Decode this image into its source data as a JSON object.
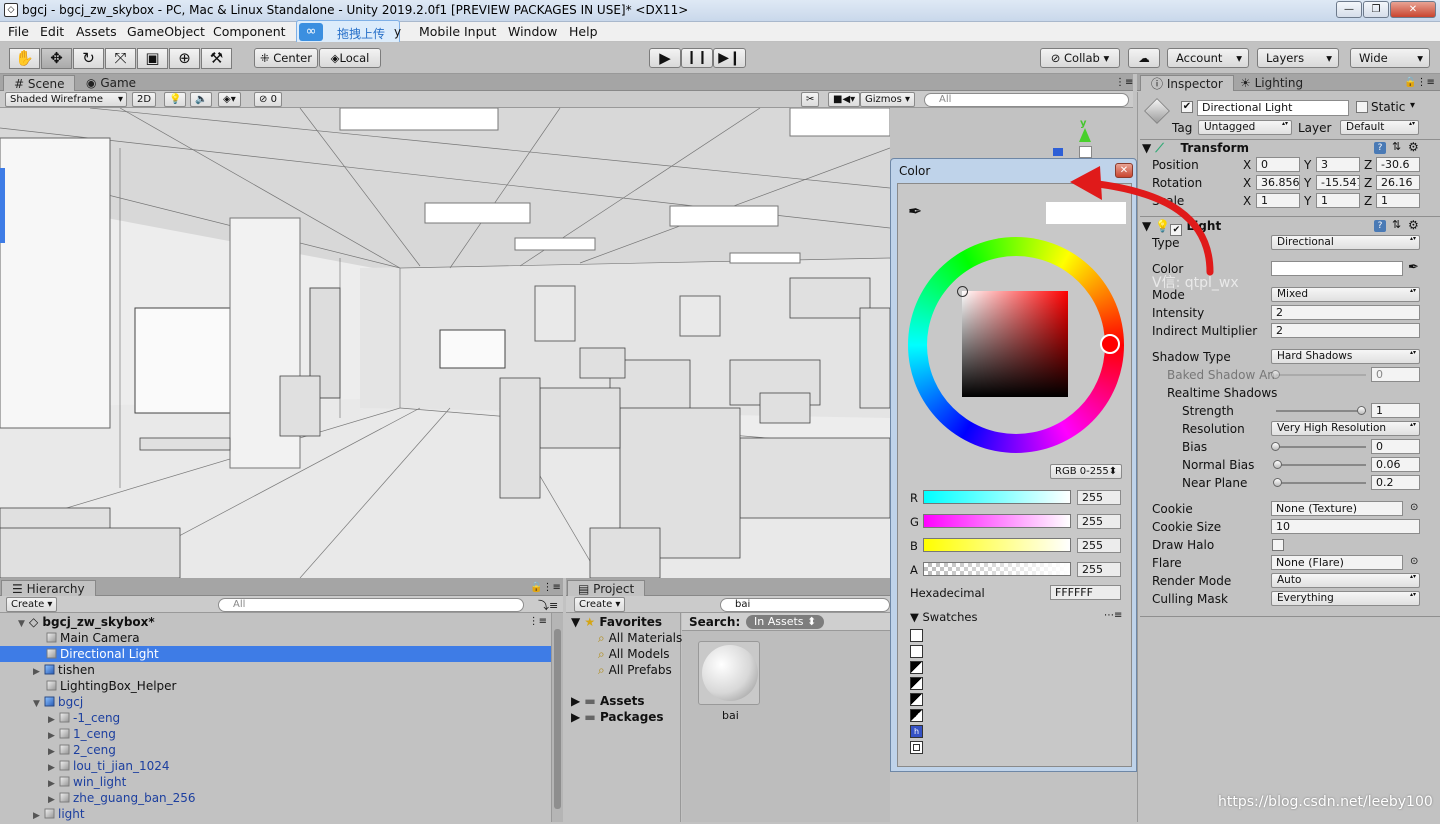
{
  "window": {
    "title": "bgcj - bgcj_zw_skybox - PC, Mac & Linux Standalone - Unity 2019.2.0f1 [PREVIEW PACKAGES IN USE]* <DX11>"
  },
  "menu": [
    "File",
    "Edit",
    "Assets",
    "GameObject",
    "Component",
    "Mobile Input",
    "Window",
    "Help"
  ],
  "overlay_popup": {
    "label": "拖拽上传",
    "trailing": "y"
  },
  "toolbar": {
    "center": "Center",
    "local": "Local",
    "collab": "Collab",
    "account": "Account",
    "layers": "Layers",
    "layout": "Wide"
  },
  "scene": {
    "tabs": [
      "Scene",
      "Game"
    ],
    "draw_mode": "Shaded Wireframe",
    "mode_2d": "2D",
    "hidden_count": "0",
    "gizmos": "Gizmos",
    "search_placeholder": "All"
  },
  "hierarchy": {
    "tab": "Hierarchy",
    "create": "Create",
    "search_placeholder": "All",
    "scene_name": "bgcj_zw_skybox*",
    "items": [
      {
        "label": "Main Camera"
      },
      {
        "label": "Directional Light"
      },
      {
        "label": "tishen"
      },
      {
        "label": "LightingBox_Helper"
      },
      {
        "label": "bgcj"
      },
      {
        "label": "-1_ceng"
      },
      {
        "label": "1_ceng"
      },
      {
        "label": "2_ceng"
      },
      {
        "label": "lou_ti_jian_1024"
      },
      {
        "label": "win_light"
      },
      {
        "label": "zhe_guang_ban_256"
      },
      {
        "label": "light"
      }
    ]
  },
  "project": {
    "tab": "Project",
    "create": "Create",
    "search_value": "bai",
    "favorites": "Favorites",
    "favorite_items": [
      "All Materials",
      "All Models",
      "All Prefabs"
    ],
    "folders": [
      "Assets",
      "Packages"
    ],
    "search_label": "Search:",
    "scope": "In Assets",
    "asset_name": "bai"
  },
  "color_picker": {
    "title": "Color",
    "mode": "RGB 0-255",
    "channels": [
      {
        "label": "R",
        "value": "255"
      },
      {
        "label": "G",
        "value": "255"
      },
      {
        "label": "B",
        "value": "255"
      },
      {
        "label": "A",
        "value": "255"
      }
    ],
    "hex_label": "Hexadecimal",
    "hex_value": "FFFFFF",
    "swatches_label": "Swatches",
    "swatch_fill": "#ffffff",
    "hue_marker_color": "#ff0000"
  },
  "inspector": {
    "tabs": [
      "Inspector",
      "Lighting"
    ],
    "object_name": "Directional Light",
    "static_label": "Static",
    "tag_label": "Tag",
    "tag_value": "Untagged",
    "layer_label": "Layer",
    "layer_value": "Default",
    "transform": {
      "title": "Transform",
      "position": {
        "label": "Position",
        "x": "0",
        "y": "3",
        "z": "-30.6"
      },
      "rotation": {
        "label": "Rotation",
        "x": "36.856",
        "y": "-15.547",
        "z": "26.16"
      },
      "scale": {
        "label": "Scale",
        "x": "1",
        "y": "1",
        "z": "1"
      }
    },
    "light": {
      "title": "Light",
      "type_label": "Type",
      "type_value": "Directional",
      "color_label": "Color",
      "mode_label": "Mode",
      "mode_value": "Mixed",
      "intensity_label": "Intensity",
      "intensity_value": "2",
      "indirect_label": "Indirect Multiplier",
      "indirect_value": "2",
      "shadow_type_label": "Shadow Type",
      "shadow_type_value": "Hard Shadows",
      "baked_label": "Baked Shadow An",
      "baked_value": "0",
      "realtime_label": "Realtime Shadows",
      "strength_label": "Strength",
      "strength_value": "1",
      "resolution_label": "Resolution",
      "resolution_value": "Very High Resolution",
      "bias_label": "Bias",
      "bias_value": "0",
      "normal_bias_label": "Normal Bias",
      "normal_bias_value": "0.06",
      "near_plane_label": "Near Plane",
      "near_plane_value": "0.2",
      "cookie_label": "Cookie",
      "cookie_value": "None (Texture)",
      "cookie_size_label": "Cookie Size",
      "cookie_size_value": "10",
      "draw_halo_label": "Draw Halo",
      "flare_label": "Flare",
      "flare_value": "None (Flare)",
      "render_mode_label": "Render Mode",
      "render_mode_value": "Auto",
      "culling_label": "Culling Mask",
      "culling_value": "Everything",
      "strength_level": 1.0,
      "normal_bias_level": 0.02,
      "near_plane_level": 0.02
    }
  },
  "watermarks": {
    "overlay": "V信: qtpl_wx",
    "footer": "https://blog.csdn.net/leeby100"
  }
}
